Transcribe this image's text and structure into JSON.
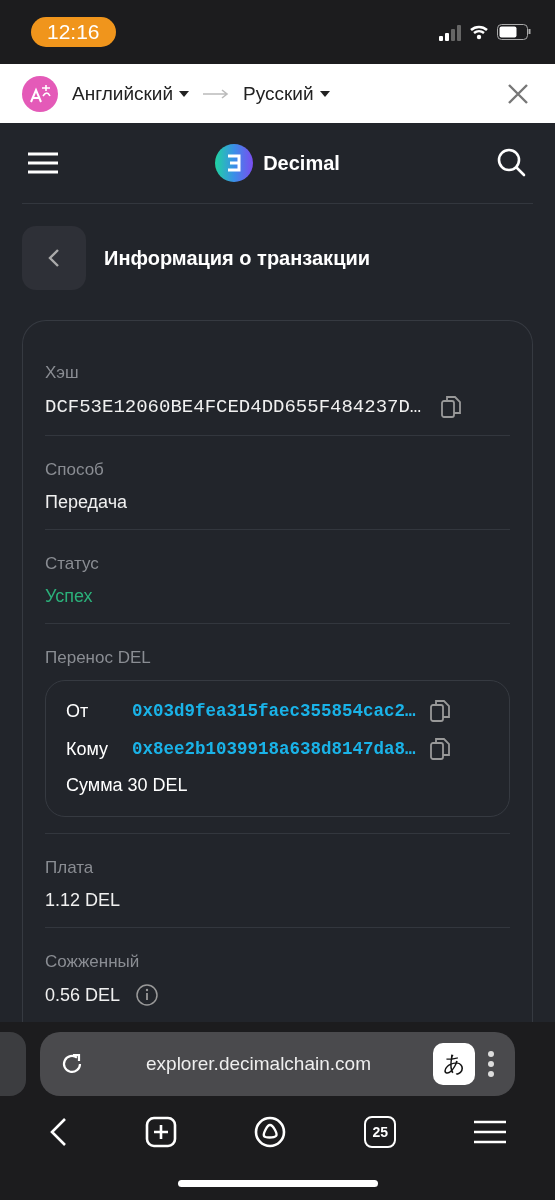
{
  "status_bar": {
    "time": "12:16"
  },
  "translate_bar": {
    "source": "Английский",
    "target": "Русский"
  },
  "site_header": {
    "logo_text": "Decimal"
  },
  "page_title": "Информация о транзакции",
  "fields": [
    {
      "kind": "hash",
      "label": "Хэш",
      "value": "DCF53E12060BE4FCED4DD655F484237D…"
    },
    {
      "kind": "text",
      "label": "Способ",
      "value": "Передача"
    },
    {
      "kind": "status",
      "label": "Статус",
      "value": "Успех"
    },
    {
      "kind": "transfer",
      "label": "Перенос DEL",
      "from_label": "От",
      "from": "0x03d9fea315faec355854cac2…",
      "to_label": "Кому",
      "to": "0x8ee2b1039918a638d8147da8…",
      "amount": "Сумма 30 DEL"
    },
    {
      "kind": "text",
      "label": "Плата",
      "value": "1.12 DEL"
    },
    {
      "kind": "info",
      "label": "Сожженный",
      "value": "0.56 DEL"
    }
  ],
  "browser": {
    "url": "explorer.decimalchain.com",
    "translate_glyph": "あ",
    "tab_count": "25"
  }
}
